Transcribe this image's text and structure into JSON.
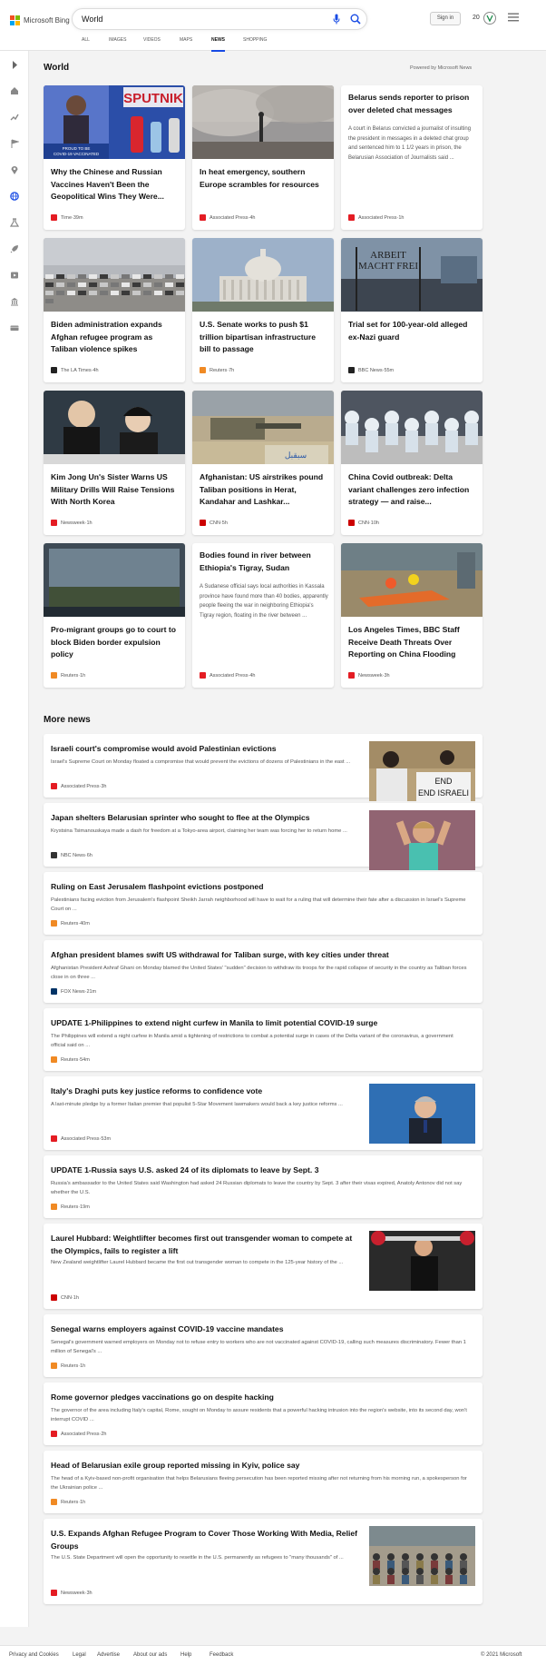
{
  "header": {
    "brand": "Microsoft Bing",
    "search_value": "World",
    "signin_label": "Sign in",
    "rewards_count": "20",
    "logo_colors": [
      "#f25022",
      "#7fba00",
      "#00a4ef",
      "#ffb900"
    ]
  },
  "nav": {
    "tabs": [
      {
        "label": "ALL",
        "active": false
      },
      {
        "label": "IMAGES",
        "active": false
      },
      {
        "label": "VIDEOS",
        "active": false
      },
      {
        "label": "MAPS",
        "active": false
      },
      {
        "label": "NEWS",
        "active": true
      },
      {
        "label": "SHOPPING",
        "active": false
      }
    ]
  },
  "sidebar": {
    "icons": [
      "expand-arrow-icon",
      "home-icon",
      "trending-icon",
      "flag-icon",
      "location-icon",
      "globe-icon",
      "science-icon",
      "rocket-icon",
      "entertainment-icon",
      "politics-icon",
      "money-icon"
    ]
  },
  "world": {
    "title": "World",
    "powered_by": "Powered by Microsoft News",
    "cards": [
      {
        "title": "Why the Chinese and Russian Vaccines Haven't Been the Geopolitical Wins They Were...",
        "provider": "Time",
        "time": "39m",
        "logo_color": "#e41c23",
        "image_text": "SPUTNIK",
        "image_caption": "PROUD TO BE COVID-19 VACCINATED"
      },
      {
        "title": "In heat emergency, southern Europe scrambles for resources",
        "provider": "Associated Press",
        "time": "4h",
        "logo_color": "#e41c23"
      },
      {
        "title": "Belarus sends reporter to prison over deleted chat messages",
        "abstract": "A court in Belarus convicted a journalist of insulting the president in messages in a deleted chat group and sentenced him to 1 1/2 years in prison, the Belarusian Association of Journalists said ...",
        "provider": "Associated Press",
        "time": "1h",
        "logo_color": "#e41c23"
      },
      {
        "title": "Biden administration expands Afghan refugee program as Taliban violence spikes",
        "provider": "The LA Times",
        "time": "4h",
        "logo_color": "#222222"
      },
      {
        "title": "U.S. Senate works to push $1 trillion bipartisan infrastructure bill to passage",
        "provider": "Reuters",
        "time": "7h",
        "logo_color": "#f08a24"
      },
      {
        "title": "Trial set for 100-year-old alleged ex-Nazi guard",
        "provider": "BBC News",
        "time": "55m",
        "logo_color": "#222222",
        "image_text": "ARBEIT MACHT FREI"
      },
      {
        "title": "Kim Jong Un's Sister Warns US Military Drills Will Raise Tensions With North Korea",
        "provider": "Newsweek",
        "time": "1h",
        "logo_color": "#e41c23"
      },
      {
        "title": "Afghanistan: US airstrikes pound Taliban positions in Herat, Kandahar and Lashkar...",
        "provider": "CNN",
        "time": "5h",
        "logo_color": "#cc0000"
      },
      {
        "title": "China Covid outbreak: Delta variant challenges zero infection strategy — and raise...",
        "provider": "CNN",
        "time": "10h",
        "logo_color": "#cc0000"
      },
      {
        "title": "Pro-migrant groups go to court to block Biden border expulsion policy",
        "provider": "Reuters",
        "time": "1h",
        "logo_color": "#f08a24"
      },
      {
        "title": "Bodies found in river between Ethiopia's Tigray, Sudan",
        "abstract": "A Sudanese official says local authorities in Kassala province have found more than 40 bodies, apparently people fleeing the war in neighboring Ethiopia's Tigray region, floating in the river between ...",
        "provider": "Associated Press",
        "time": "4h",
        "logo_color": "#e41c23"
      },
      {
        "title": "Los Angeles Times, BBC Staff Receive Death Threats Over Reporting on China Flooding",
        "provider": "Newsweek",
        "time": "3h",
        "logo_color": "#e41c23"
      }
    ]
  },
  "more_news": {
    "title": "More news",
    "items": [
      {
        "title": "Israeli court's compromise would avoid Palestinian evictions",
        "abstract": "Israel's Supreme Court on Monday floated a compromise that would prevent the evictions of dozens of Palestinians in the east ...",
        "provider": "Associated Press",
        "time": "3h",
        "logo_color": "#e41c23",
        "image_text": "END ISRAELI"
      },
      {
        "title": "Japan shelters Belarusian sprinter who sought to flee at the Olympics",
        "abstract": "Krystsina Tsimanouskaya made a dash for freedom at a Tokyo-area airport, claiming her team was forcing her to return home ...",
        "provider": "NBC News",
        "time": "6h",
        "logo_color": "#333333"
      },
      {
        "title": "Ruling on East Jerusalem flashpoint evictions postponed",
        "abstract": "Palestinians facing eviction from Jerusalem's flashpoint Sheikh Jarrah neighborhood will have to wait for a ruling that will determine their fate after a discussion in Israel's Supreme Court on ...",
        "provider": "Reuters",
        "time": "40m",
        "logo_color": "#f08a24"
      },
      {
        "title": "Afghan president blames swift US withdrawal for Taliban surge, with key cities under threat",
        "abstract": "Afghanistan President Ashraf Ghani on Monday blamed the United States' \"sudden\" decision to withdraw its troops for the rapid collapse of security in the country as Taliban forces close in on three ...",
        "provider": "FOX News",
        "time": "21m",
        "logo_color": "#003366"
      },
      {
        "title": "UPDATE 1-Philippines to extend night curfew in Manila to limit potential COVID-19 surge",
        "abstract": "The Philippines will extend a night curfew in Manila amid a tightening of restrictions to combat a potential surge in cases of the Delta variant of the coronavirus, a government official said on ...",
        "provider": "Reuters",
        "time": "54m",
        "logo_color": "#f08a24"
      },
      {
        "title": "Italy's Draghi puts key justice reforms to confidence vote",
        "abstract": "A last-minute pledge by a former Italian premier that populist 5-Star Movement lawmakers would back a key justice reforms ...",
        "provider": "Associated Press",
        "time": "53m",
        "logo_color": "#e41c23"
      },
      {
        "title": "UPDATE 1-Russia says U.S. asked 24 of its diplomats to leave by Sept. 3",
        "abstract": "Russia's ambassador to the United States said Washington had asked 24 Russian diplomats to leave the country by Sept. 3 after their visas expired, Anatoly Antonov did not say whether the U.S.",
        "provider": "Reuters",
        "time": "19m",
        "logo_color": "#f08a24"
      },
      {
        "title": "Laurel Hubbard: Weightlifter becomes first out transgender woman to compete at the Olympics, fails to register a lift",
        "abstract": "New Zealand weightlifter Laurel Hubbard became the first out transgender woman to compete in the 125-year history of the ...",
        "provider": "CNN",
        "time": "1h",
        "logo_color": "#cc0000"
      },
      {
        "title": "Senegal warns employers against COVID-19 vaccine mandates",
        "abstract": "Senegal's government warned employers on Monday not to refuse entry to workers who are not vaccinated against COVID-19, calling such measures discriminatory. Fewer than 1 million of Senegal's ...",
        "provider": "Reuters",
        "time": "1h",
        "logo_color": "#f08a24"
      },
      {
        "title": "Rome governor pledges vaccinations go on despite hacking",
        "abstract": "The governor of the area including Italy's capital, Rome, sought on Monday to assure residents that a powerful hacking intrusion into the region's website, into its second day, won't interrupt COVID ...",
        "provider": "Associated Press",
        "time": "2h",
        "logo_color": "#e41c23"
      },
      {
        "title": "Head of Belarusian exile group reported missing in Kyiv, police say",
        "abstract": "The head of a Kyiv-based non-profit organisation that helps Belarusians fleeing persecution has been reported missing after not returning from his morning run, a spokesperson for the Ukrainian police ...",
        "provider": "Reuters",
        "time": "1h",
        "logo_color": "#f08a24"
      },
      {
        "title": "U.S. Expands Afghan Refugee Program to Cover Those Working With Media, Relief Groups",
        "abstract": "The U.S. State Department will open the opportunity to resettle in the U.S. permanently as refugees to \"many thousands\" of ...",
        "provider": "Newsweek",
        "time": "3h",
        "logo_color": "#e41c23"
      }
    ]
  },
  "footer": {
    "links": [
      "Privacy and Cookies",
      "Legal",
      "Advertise",
      "About our ads",
      "Help",
      "Feedback"
    ],
    "copyright": "© 2021 Microsoft"
  }
}
